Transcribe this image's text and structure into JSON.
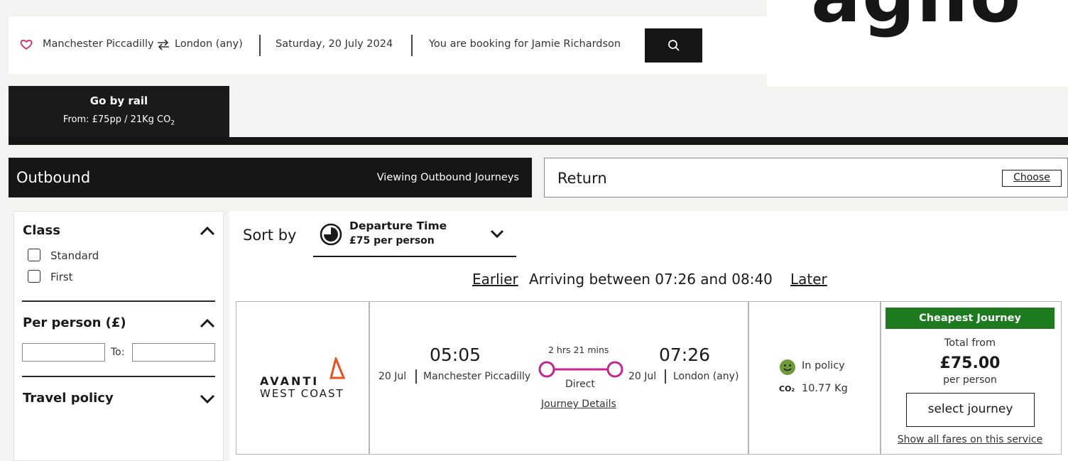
{
  "brand": {
    "logo_text": "agilo"
  },
  "search": {
    "origin": "Manchester Piccadilly",
    "destination": "London (any)",
    "date": "Saturday, 20 July 2024",
    "booking_for": "You are booking for Jamie  Richardson"
  },
  "mode_tab": {
    "title": "Go by rail",
    "subtitle_prefix": "From: £75pp / 21Kg CO",
    "subtitle_sub": "2"
  },
  "legs": {
    "outbound_label": "Outbound",
    "outbound_status": "Viewing Outbound Journeys",
    "return_label": "Return",
    "choose_label": "Choose"
  },
  "filters": {
    "class_heading": "Class",
    "class_options": [
      "Standard",
      "First"
    ],
    "price_heading": "Per person (£)",
    "to_label": "To:",
    "from_value": "",
    "to_value": "",
    "policy_heading": "Travel policy"
  },
  "sort": {
    "label": "Sort by",
    "selected_title": "Departure Time",
    "selected_sub": "£75 per person"
  },
  "pager": {
    "earlier": "Earlier",
    "arriving": "Arriving between 07:26 and 08:40",
    "later": "Later"
  },
  "journey": {
    "operator_line1": "AVANTI",
    "operator_line2": "WEST COAST",
    "dep_time": "05:05",
    "dep_date": "20 Jul",
    "dep_station": "Manchester Piccadilly",
    "duration": "2 hrs 21 mins",
    "stops": "Direct",
    "details_link": "Journey Details",
    "arr_time": "07:26",
    "arr_date": "20 Jul",
    "arr_station": "London (any)",
    "policy": "In policy",
    "co2_label": "CO₂",
    "co2_value": "10.77 Kg",
    "badge": "Cheapest Journey",
    "total_from": "Total from",
    "price": "£75.00",
    "per_person": "per  person",
    "select_label": "select journey",
    "show_fares": "Show all fares on this service"
  },
  "colors": {
    "accent_dark": "#161616",
    "cheapest_green": "#1e7a1e",
    "route_magenta": "#c0288c",
    "operator_orange": "#e8501e",
    "heart_pink": "#d61b5b"
  }
}
